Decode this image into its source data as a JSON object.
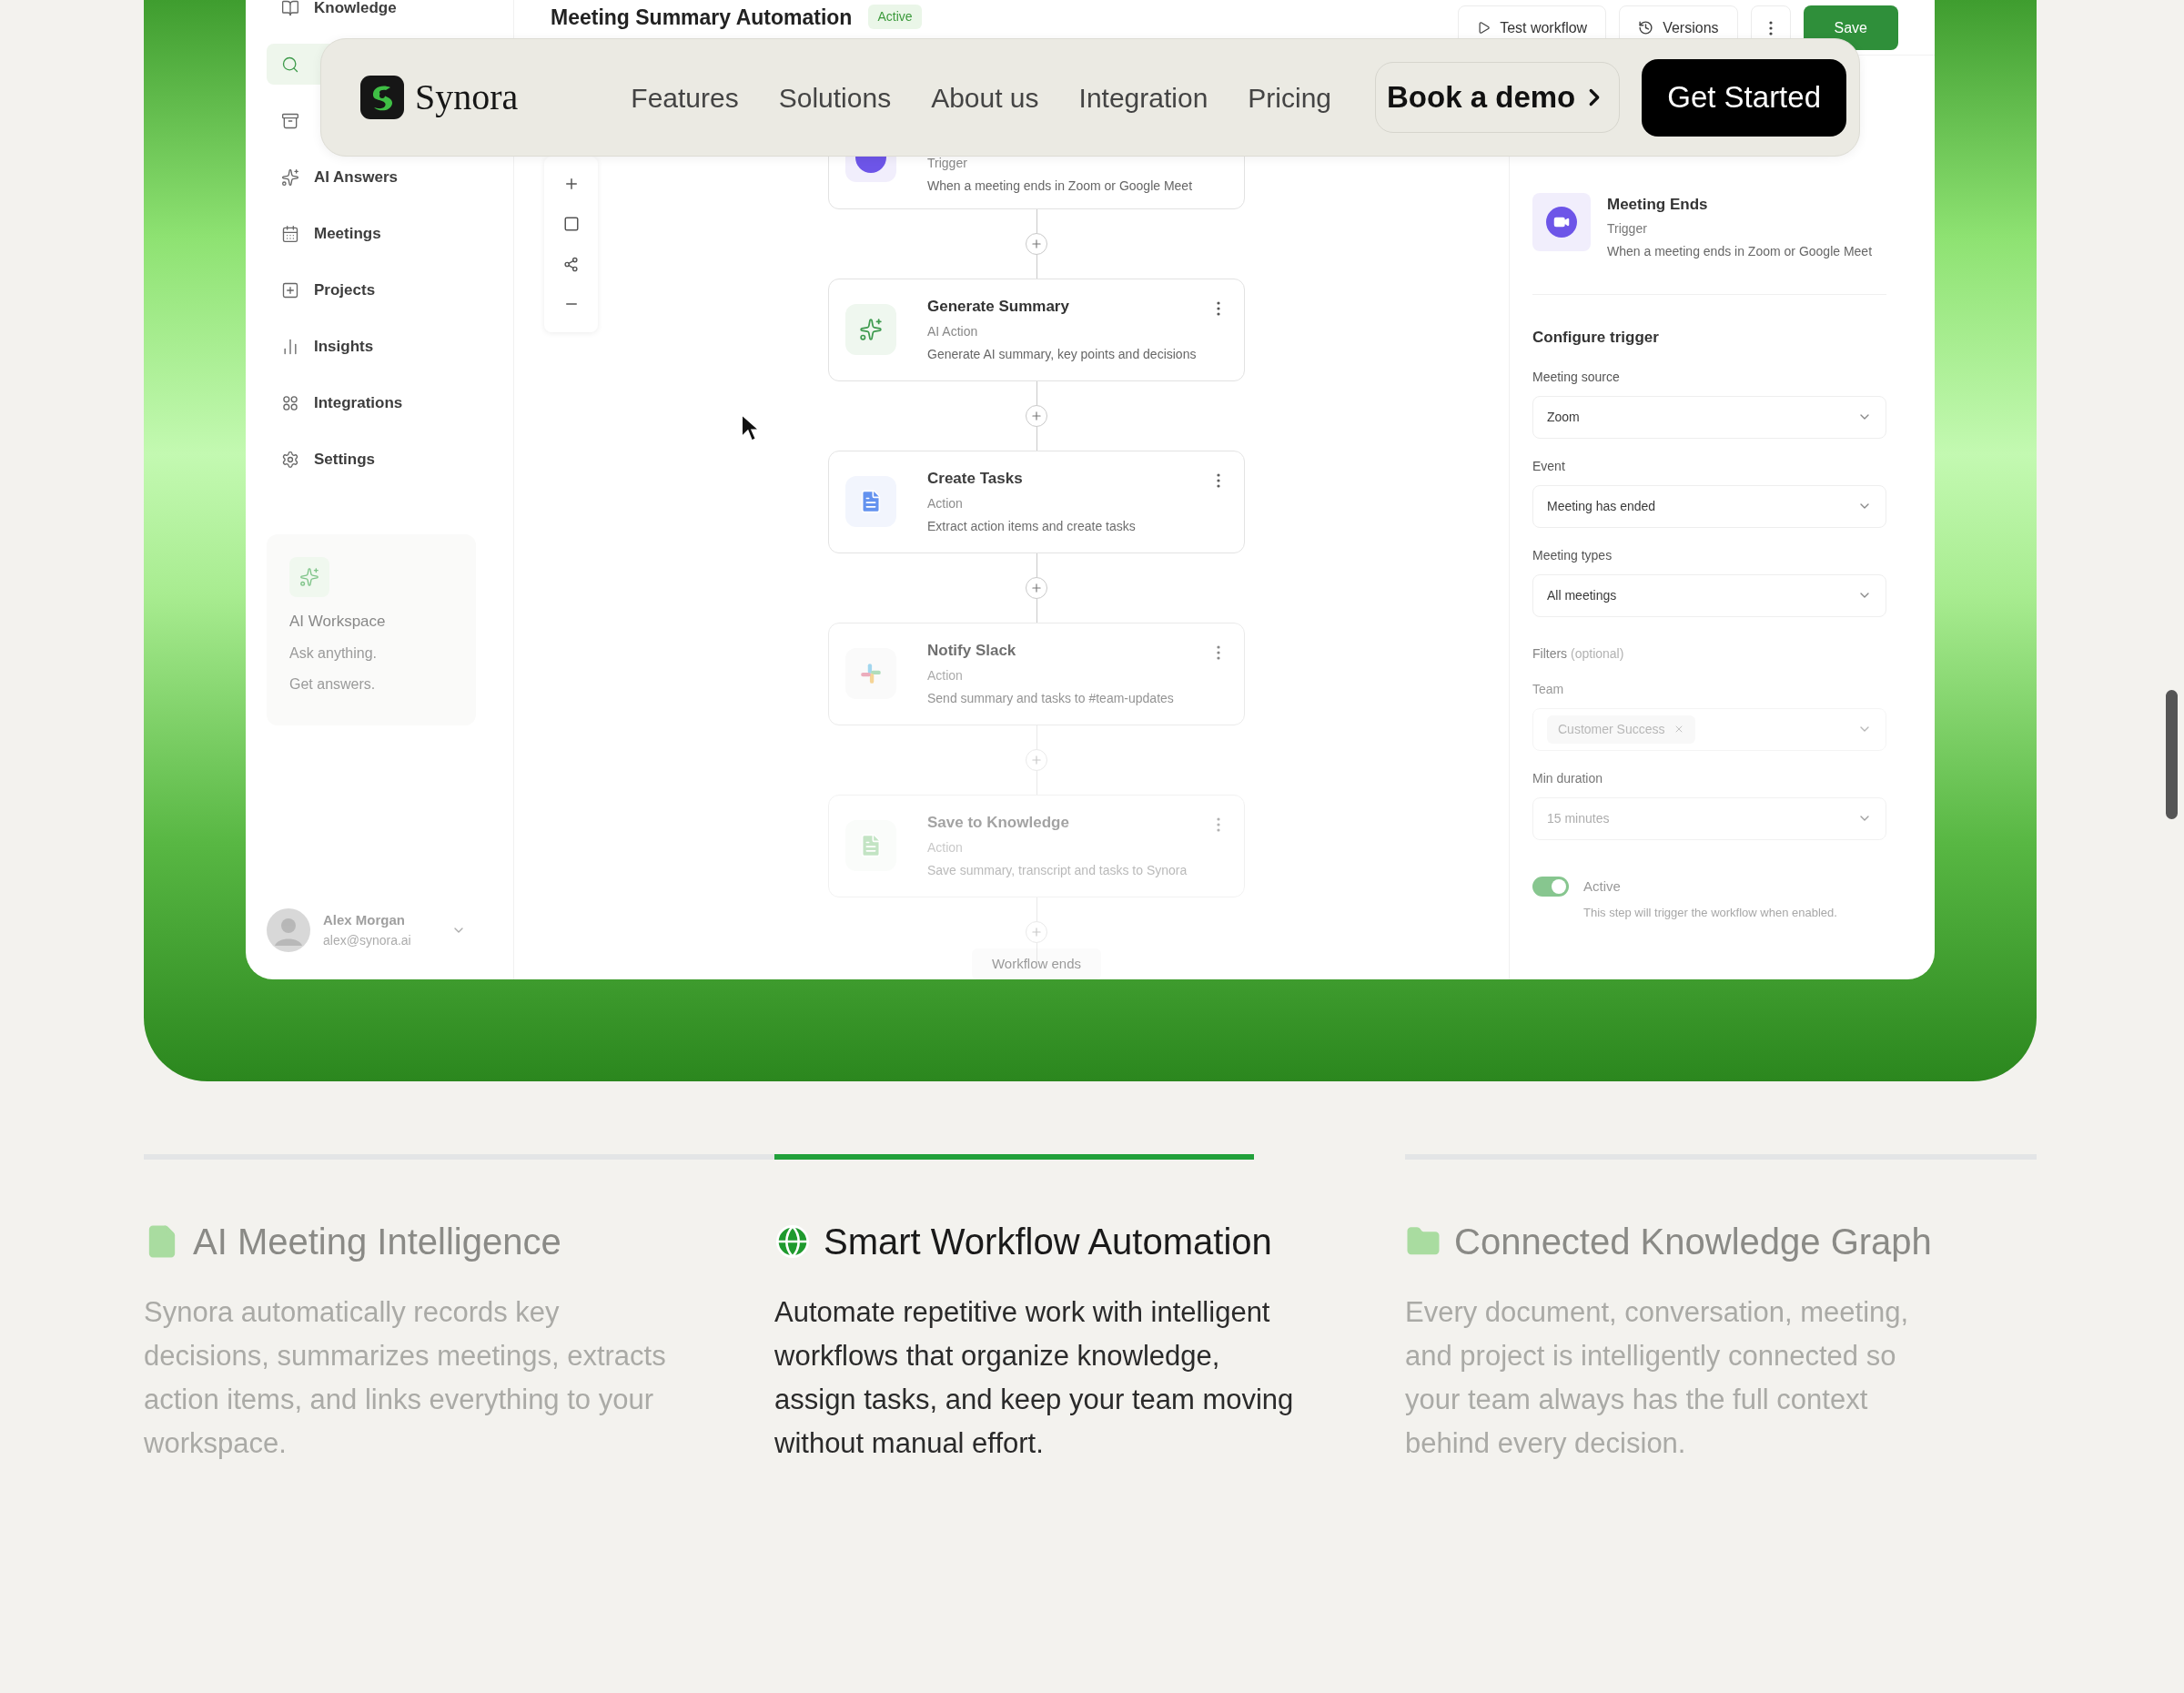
{
  "nav": {
    "brand": "Synora",
    "links": [
      "Features",
      "Solutions",
      "About us",
      "Integration",
      "Pricing"
    ],
    "demo": "Book a demo",
    "cta": "Get Started"
  },
  "app": {
    "sidebar": {
      "items": [
        {
          "label": "Knowledge",
          "selected": false
        },
        {
          "selected": true
        },
        {
          "selected": false
        },
        {
          "label": "AI Answers",
          "selected": false
        },
        {
          "label": "Meetings",
          "selected": false
        },
        {
          "label": "Projects",
          "selected": false
        },
        {
          "label": "Insights",
          "selected": false
        },
        {
          "label": "Integrations",
          "selected": false
        },
        {
          "label": "Settings",
          "selected": false
        }
      ],
      "workspace_card": {
        "title": "AI Workspace",
        "lines": [
          "Ask anything.",
          "Get answers."
        ]
      },
      "user": {
        "name": "Alex Morgan",
        "email": "alex@synora.ai"
      }
    },
    "header": {
      "title": "Meeting Summary Automation",
      "status": "Active",
      "buttons": [
        "Test workflow",
        "Versions"
      ],
      "save": "Save"
    },
    "flow": {
      "steps": [
        {
          "kind": "trigger",
          "subtitle": "Trigger",
          "description": "When a meeting ends in Zoom or Google Meet"
        },
        {
          "kind": "ai",
          "title": "Generate Summary",
          "subtitle": "AI Action",
          "description": "Generate AI summary, key points and decisions"
        },
        {
          "kind": "tasks",
          "title": "Create Tasks",
          "subtitle": "Action",
          "description": "Extract action items and create tasks"
        },
        {
          "kind": "slack",
          "title": "Notify Slack",
          "subtitle": "Action",
          "description": "Send summary and tasks to #team-updates"
        },
        {
          "kind": "knowledge",
          "title": "Save to Knowledge",
          "subtitle": "Action",
          "description": "Save summary, transcript and tasks to Synora"
        }
      ],
      "end_label": "Workflow ends"
    },
    "panel": {
      "trigger": {
        "title": "Meeting Ends",
        "subtitle": "Trigger",
        "description": "When a meeting ends in Zoom or Google Meet"
      },
      "section_title": "Configure trigger",
      "fields": [
        {
          "label": "Meeting source",
          "value": "Zoom"
        },
        {
          "label": "Event",
          "value": "Meeting has ended"
        },
        {
          "label": "Meeting types",
          "value": "All meetings"
        }
      ],
      "filters": {
        "label": "Filters",
        "note": "(optional)"
      },
      "team": {
        "label": "Team",
        "chip": "Customer Success"
      },
      "duration": {
        "label": "Min duration",
        "value": "15 minutes"
      },
      "toggle": {
        "label": "Active",
        "on": true,
        "hint": "This step will trigger the workflow when enabled."
      }
    }
  },
  "features": [
    {
      "kind": "file",
      "title": "AI Meeting Intelligence",
      "body": "Synora automatically records key decisions, summarizes meetings, extracts action items, and links everything to your workspace.",
      "selected": false
    },
    {
      "kind": "globe",
      "title": "Smart Workflow Automation",
      "body": "Automate repetitive work with intelligent workflows that organize knowledge, assign tasks, and keep your team moving without manual effort.",
      "selected": true
    },
    {
      "kind": "folder",
      "title": "Connected Knowledge Graph",
      "body": "Every document, conversation, meeting, and project is intelligently connected so your team always has the full context behind every decision.",
      "selected": false
    }
  ]
}
